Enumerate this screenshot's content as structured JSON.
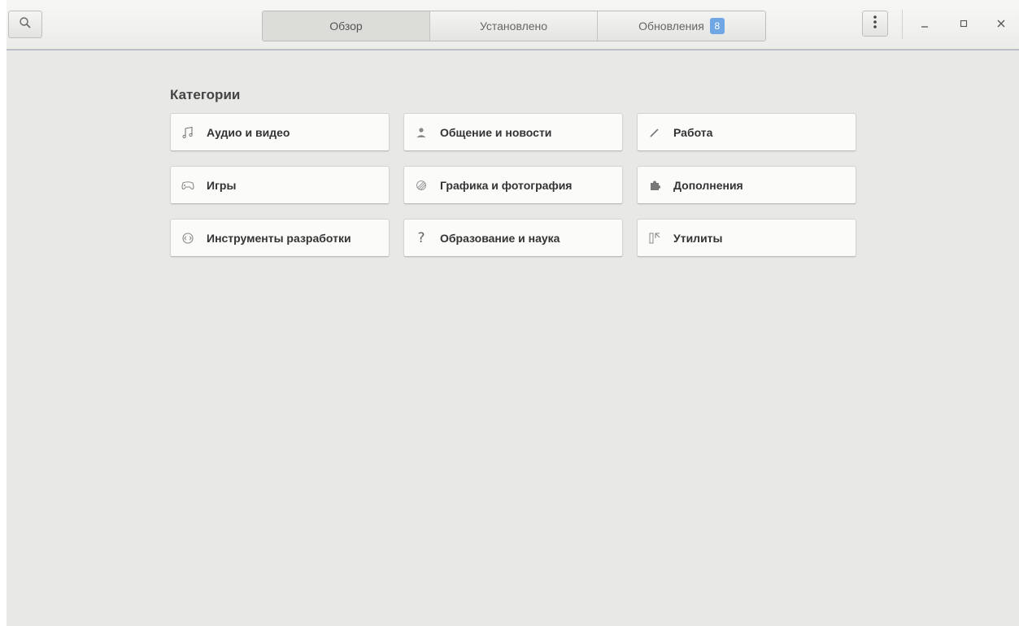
{
  "header": {
    "tabs": [
      {
        "label": "Обзор",
        "active": true
      },
      {
        "label": "Установлено",
        "active": false
      },
      {
        "label": "Обновления",
        "active": false,
        "badge": "8"
      }
    ]
  },
  "icons": {
    "search": "search-icon",
    "menu": "vertical-dots-icon",
    "minimize": "minimize-icon",
    "maximize": "maximize-icon",
    "close": "close-icon"
  },
  "colors": {
    "badge": "#6fa6e4",
    "background": "#e8e8e7",
    "tile": "#fbfbfa",
    "accent_line": "#aab4c4"
  },
  "main": {
    "section_title": "Категории",
    "categories": [
      {
        "label": "Аудио и видео",
        "icon": "music-note-icon"
      },
      {
        "label": "Общение и новости",
        "icon": "person-icon"
      },
      {
        "label": "Работа",
        "icon": "pencil-icon"
      },
      {
        "label": "Игры",
        "icon": "gamepad-icon"
      },
      {
        "label": "Графика и фотография",
        "icon": "graphics-icon"
      },
      {
        "label": "Дополнения",
        "icon": "puzzle-icon"
      },
      {
        "label": "Инструменты разработки",
        "icon": "code-icon"
      },
      {
        "label": "Образование и наука",
        "icon": "question-icon"
      },
      {
        "label": "Утилиты",
        "icon": "utilities-icon"
      }
    ]
  }
}
